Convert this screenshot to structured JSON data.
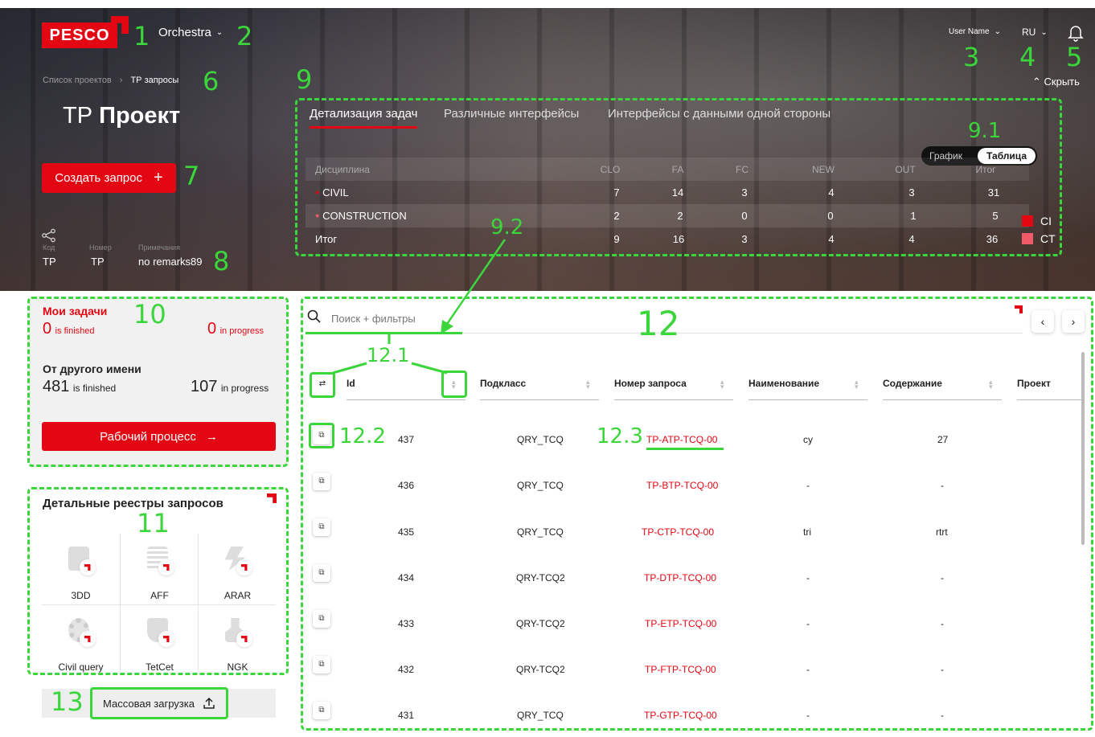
{
  "header": {
    "logo": "PESCO",
    "app_name": "Orchestra",
    "user_name": "User Name",
    "language": "RU",
    "hide_label": "Скрыть"
  },
  "breadcrumb": {
    "parent": "Список проектов",
    "sep": "›",
    "current": "ТР запросы"
  },
  "project": {
    "title_prefix": "ТР",
    "title_main": "Проект",
    "create_label": "Создать запрос",
    "meta": [
      {
        "label": "Код",
        "value": "TP"
      },
      {
        "label": "Номер",
        "value": "TP"
      },
      {
        "label": "Примечания",
        "value": "no remarks89"
      }
    ]
  },
  "tabs": [
    {
      "label": "Детализация задач",
      "active": true
    },
    {
      "label": "Различные интерфейсы",
      "active": false
    },
    {
      "label": "Интерфейсы с данными одной стороны",
      "active": false
    }
  ],
  "view_toggle": {
    "options": [
      "График",
      "Таблица"
    ],
    "active": "Таблица"
  },
  "summary_table": {
    "headers": [
      "Дисциплина",
      "CLO",
      "FA",
      "FC",
      "NEW",
      "OUT",
      "Итог"
    ],
    "rows": [
      {
        "name": "CIVIL",
        "dot": true,
        "values": [
          "7",
          "14",
          "3",
          "4",
          "3",
          "31"
        ]
      },
      {
        "name": "CONSTRUCTION",
        "dot": true,
        "values": [
          "2",
          "2",
          "0",
          "0",
          "1",
          "5"
        ]
      },
      {
        "name": "Итог",
        "dot": false,
        "values": [
          "9",
          "16",
          "3",
          "4",
          "4",
          "36"
        ]
      }
    ]
  },
  "legend": [
    {
      "label": "CI",
      "color": "#e30613"
    },
    {
      "label": "CT",
      "color": "#f25a6a"
    }
  ],
  "my_tasks": {
    "title": "Мои задачи",
    "finished_count": "0",
    "finished_label": "is finished",
    "progress_count": "0",
    "progress_label": "in progress"
  },
  "others": {
    "title": "От другого имени",
    "finished_count": "481",
    "finished_label": "is finished",
    "progress_count": "107",
    "progress_label": "in progress"
  },
  "workflow_label": "Рабочий процесс",
  "registers": {
    "title": "Детальные реестры запросов",
    "items": [
      "3DD",
      "AFF",
      "ARAR",
      "Civil query",
      "TetCet",
      "NGK"
    ]
  },
  "bulk_upload_label": "Массовая загрузка",
  "search": {
    "placeholder": "Поиск + фильтры"
  },
  "columns": [
    "Id",
    "Подкласс",
    "Номер запроса",
    "Наименование",
    "Содержание",
    "Проект"
  ],
  "rows": [
    {
      "id": "437",
      "sub": "QRY_TCQ",
      "num": "TP-ATP-TCQ-00",
      "name": "cy",
      "content": "27"
    },
    {
      "id": "436",
      "sub": "QRY_TCQ",
      "num": "TP-BTP-TCQ-00",
      "name": "-",
      "content": "-"
    },
    {
      "id": "435",
      "sub": "QRY_TCQ",
      "num": "TP-CTP-TCQ-00",
      "name": "tri",
      "content": "rtrt"
    },
    {
      "id": "434",
      "sub": "QRY-TCQ2",
      "num": "TP-DTP-TCQ-00",
      "name": "-",
      "content": "-"
    },
    {
      "id": "433",
      "sub": "QRY-TCQ2",
      "num": "TP-ETP-TCQ-00",
      "name": "-",
      "content": "-"
    },
    {
      "id": "432",
      "sub": "QRY-TCQ2",
      "num": "TP-FTP-TCQ-00",
      "name": "-",
      "content": "-"
    },
    {
      "id": "431",
      "sub": "QRY_TCQ",
      "num": "TP-GTP-TCQ-00",
      "name": "-",
      "content": "-"
    }
  ],
  "annotations": [
    "1",
    "2",
    "3",
    "4",
    "5",
    "6",
    "7",
    "8",
    "9",
    "9.1",
    "9.2",
    "10",
    "11",
    "12",
    "12.1",
    "12.2",
    "12.3",
    "13"
  ],
  "colors": {
    "accent": "#e30613",
    "annotation": "#3bd63b"
  }
}
